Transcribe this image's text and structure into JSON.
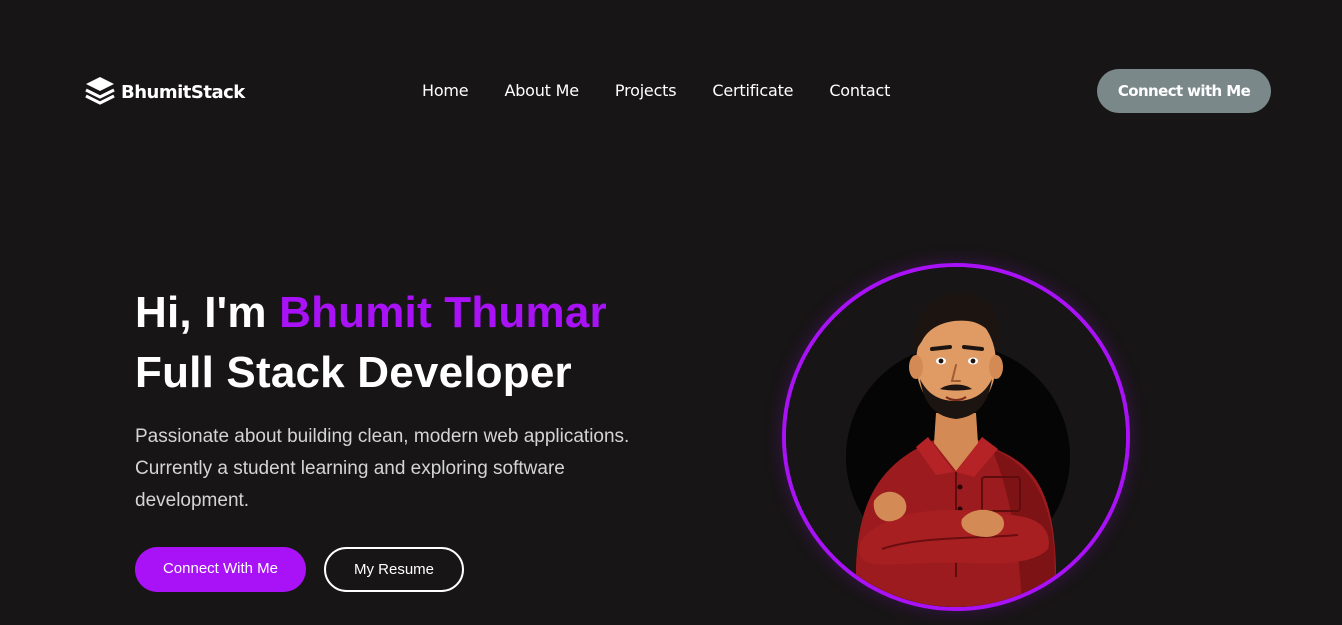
{
  "brand": {
    "name": "BhumitStack",
    "logo_icon": "stacked-layers-icon"
  },
  "nav": {
    "items": [
      {
        "label": "Home"
      },
      {
        "label": "About Me"
      },
      {
        "label": "Projects"
      },
      {
        "label": "Certificate"
      },
      {
        "label": "Contact"
      }
    ],
    "cta_label": "Connect with Me"
  },
  "hero": {
    "greeting": "Hi, I'm",
    "name": "Bhumit Thumar",
    "role": "Full Stack Developer",
    "description": "Passionate about building clean, modern web applications. Currently a student learning and exploring software development.",
    "primary_button": "Connect With Me",
    "secondary_button": "My Resume"
  },
  "avatar": {
    "icon": "developer-avatar-illustration"
  },
  "colors": {
    "background": "#171515",
    "accent": "#a912f7",
    "nav_button": "#7b888a",
    "text": "#ffffff",
    "muted_text": "#d4d4d4"
  }
}
